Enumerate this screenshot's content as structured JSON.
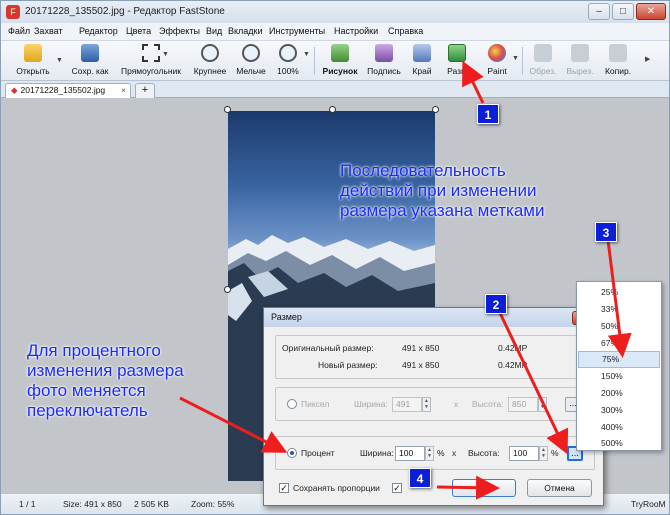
{
  "window": {
    "title": "20171228_135502.jpg - Редактор FastStone",
    "app_icon": "faststone-app-icon",
    "controls": [
      "–",
      "□",
      "✕"
    ]
  },
  "menu": [
    "Файл",
    "Захват",
    "Редактор",
    "Цвета",
    "Эффекты",
    "Вид",
    "Вкладки",
    "Инструменты",
    "Настройки",
    "Справка"
  ],
  "toolbar": {
    "open": "Открыть",
    "save_as": "Сохр. как",
    "rectangle": "Прямоугольник",
    "zoom_in": "Крупнее",
    "zoom_out": "Мельче",
    "zoom_100": "100%",
    "draw": "Рисунок",
    "caption": "Подпись",
    "edge": "Край",
    "resize": "Разм",
    "paint": "Paint",
    "crop": "Обрез.",
    "cut": "Вырез.",
    "copy": "Копир."
  },
  "tabs": {
    "active": "20171228_135502.jpg",
    "close": "×",
    "add": "+"
  },
  "annotations": {
    "sequence": [
      "Последовательность",
      "действий при изменении",
      "размера указана метками"
    ],
    "percent_note": [
      "Для процентного",
      "изменения размера",
      "фото меняется",
      "переключатель"
    ],
    "badges": [
      "1",
      "2",
      "3",
      "4"
    ]
  },
  "dialog": {
    "title": "Размер",
    "close": "✕",
    "original_size_label": "Оригинальный размер:",
    "original_size_value": "491 x 850",
    "original_mp": "0.42MP",
    "new_size_label": "Новый размер:",
    "new_size_value": "491 x 850",
    "new_mp": "0.42MP",
    "pixel_option": "Пиксел",
    "width_label": "Ширина:",
    "pixel_width": "491",
    "times": "x",
    "height_label": "Высота:",
    "pixel_height": "850",
    "percent_option": "Процент",
    "percent_width": "100",
    "percent_height": "100",
    "percent_unit": "%",
    "dots": "...",
    "keep_proportions": "Сохранять пропорции",
    "ok": "OK",
    "cancel": "Отмена"
  },
  "percent_menu": {
    "items": [
      "25%",
      "33%",
      "50%",
      "67%",
      "75%",
      "150%",
      "200%",
      "300%",
      "400%",
      "500%"
    ],
    "selected": "75%"
  },
  "statusbar": {
    "page": "1 / 1",
    "size": "Size: 491 x 850",
    "file_size": "2 505 KB",
    "zoom": "Zoom: 55%",
    "watermark": "TryRooM"
  }
}
